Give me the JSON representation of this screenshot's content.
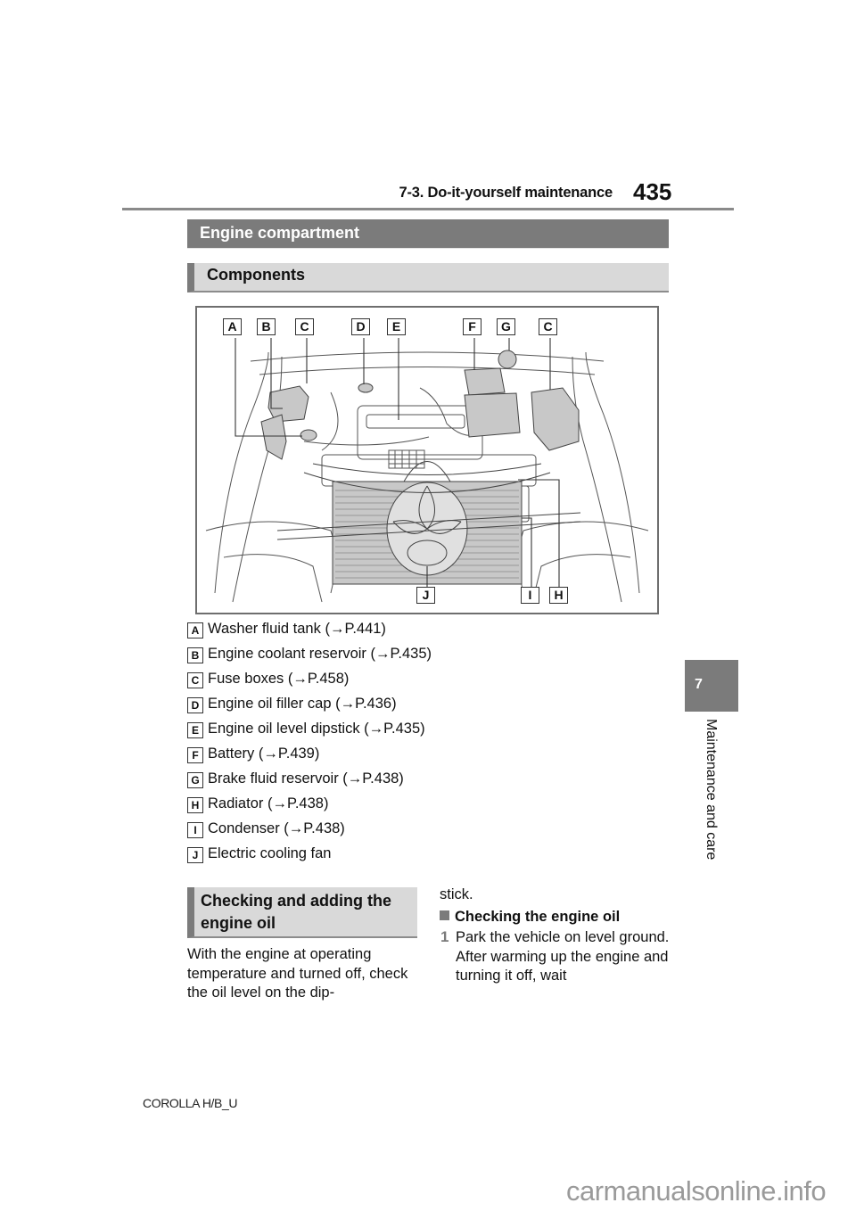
{
  "header": {
    "section": "7-3. Do-it-yourself maintenance",
    "page_number": "435"
  },
  "section_title": "Engine compartment",
  "subsection_title": "Components",
  "diagram": {
    "top_labels": [
      "A",
      "B",
      "C",
      "D",
      "E",
      "F",
      "G",
      "C"
    ],
    "bottom_labels": [
      "J",
      "I",
      "H"
    ]
  },
  "components": [
    {
      "key": "A",
      "text": "Washer fluid tank (→P.441)"
    },
    {
      "key": "B",
      "text": "Engine coolant reservoir (→P.435)"
    },
    {
      "key": "C",
      "text": "Fuse boxes (→P.458)"
    },
    {
      "key": "D",
      "text": "Engine oil filler cap (→P.436)"
    },
    {
      "key": "E",
      "text": "Engine oil level dipstick (→P.435)"
    },
    {
      "key": "F",
      "text": "Battery (→P.439)"
    },
    {
      "key": "G",
      "text": "Brake fluid reservoir (→P.438)"
    },
    {
      "key": "H",
      "text": "Radiator (→P.438)"
    },
    {
      "key": "I",
      "text": "Condenser (→P.438)"
    },
    {
      "key": "J",
      "text": "Electric cooling fan"
    }
  ],
  "oil_section": {
    "title": "Checking and adding the engine oil",
    "intro": "With the engine at operating temperature and turned off, check the oil level on the dip-",
    "intro_continued": "stick.",
    "subheading": "Checking the engine oil",
    "steps": [
      {
        "number": "1",
        "text": "Park the vehicle on level ground. After warming up the engine and turning it off, wait"
      }
    ]
  },
  "chapter_tab": {
    "number": "7",
    "label": "Maintenance and care"
  },
  "footer": {
    "model": "COROLLA H/B_U"
  },
  "watermark": "carmanualsonline.info"
}
